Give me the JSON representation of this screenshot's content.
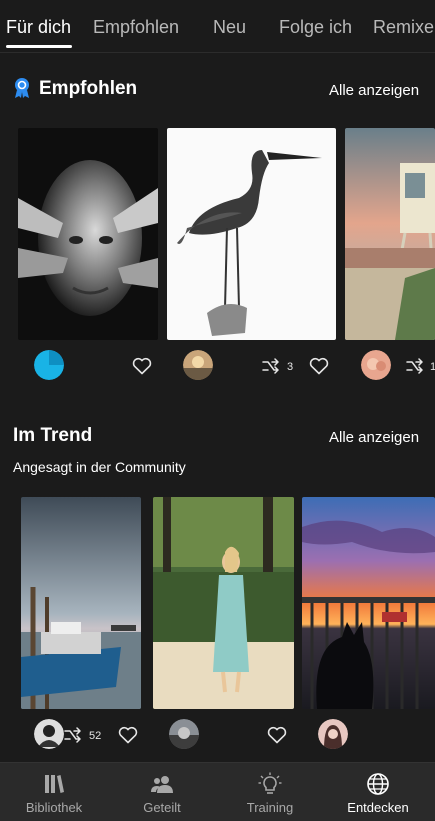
{
  "tabs": [
    {
      "label": "Für dich",
      "active": true
    },
    {
      "label": "Empfohlen",
      "active": false
    },
    {
      "label": "Neu",
      "active": false
    },
    {
      "label": "Folge ich",
      "active": false
    },
    {
      "label": "Remixe",
      "active": false
    }
  ],
  "featured": {
    "title": "Empfohlen",
    "see_all": "Alle anzeigen",
    "badge_icon": "award-ribbon-icon",
    "items": [
      {
        "photo": "bw-portrait-hands",
        "remix_count": ""
      },
      {
        "photo": "heron-bw",
        "remix_count": "3"
      },
      {
        "photo": "lifeguard-tower-beach",
        "remix_count": "1"
      }
    ]
  },
  "trending": {
    "title": "Im Trend",
    "see_all": "Alle anzeigen",
    "subtitle": "Angesagt in der Community",
    "items": [
      {
        "photo": "harbor-boat",
        "remix_count": "52"
      },
      {
        "photo": "woman-floral-dress",
        "remix_count": ""
      },
      {
        "photo": "sunset-cat-silhouette",
        "remix_count": ""
      }
    ]
  },
  "bottom_nav": [
    {
      "label": "Bibliothek",
      "icon": "library-icon",
      "active": false
    },
    {
      "label": "Geteilt",
      "icon": "shared-people-icon",
      "active": false
    },
    {
      "label": "Training",
      "icon": "lightbulb-icon",
      "active": false
    },
    {
      "label": "Entdecken",
      "icon": "globe-icon",
      "active": true
    }
  ],
  "colors": {
    "background": "#1b1b1b",
    "active_tab": "#ffffff",
    "inactive_tab": "#b9b9b9",
    "badge_blue": "#2d8cf0"
  }
}
